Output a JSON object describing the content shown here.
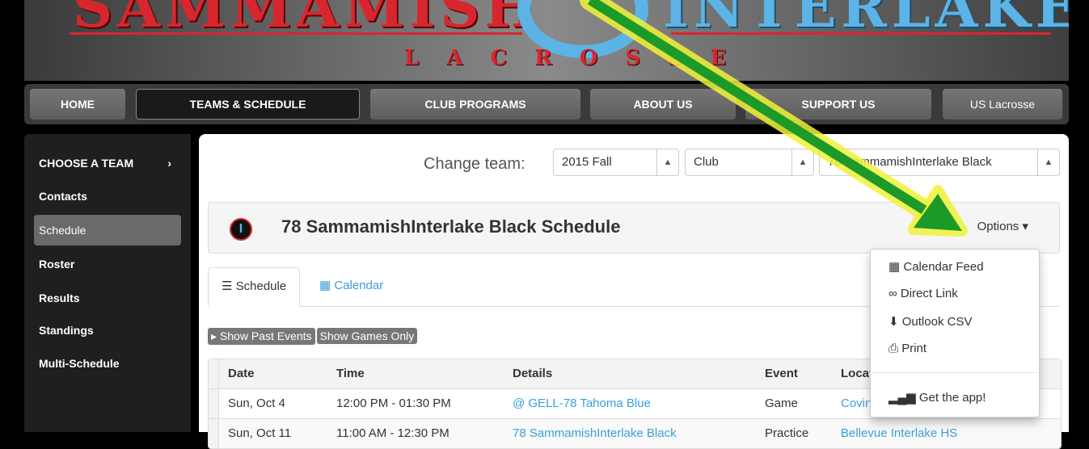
{
  "banner": {
    "left_word": "SAMMAMISH",
    "right_word": "INTERLAKE",
    "sub_word": "LACROSSE",
    "colors": {
      "red": "#d8262e",
      "blue": "#5bb4e5"
    }
  },
  "nav": {
    "items": [
      "HOME",
      "TEAMS & SCHEDULE",
      "CLUB PROGRAMS",
      "ABOUT US",
      "SUPPORT US",
      "US Lacrosse"
    ],
    "active": "TEAMS & SCHEDULE"
  },
  "sidebar": {
    "header": "CHOOSE A TEAM",
    "header_icon": "chevron-right-icon",
    "items": [
      "Contacts",
      "Schedule",
      "Roster",
      "Results",
      "Standings",
      "Multi-Schedule"
    ],
    "active": "Schedule"
  },
  "change_team": {
    "label": "Change team:",
    "season": "2015 Fall",
    "program": "Club",
    "team": "78 SammamishInterlake Black"
  },
  "schedule": {
    "title": "78 SammamishInterlake Black Schedule",
    "options_label": "Options",
    "tabs": [
      {
        "label": "Schedule",
        "icon": "list-icon"
      },
      {
        "label": "Calendar",
        "icon": "calendar-icon"
      }
    ],
    "buttons": {
      "past": "Show Past Events",
      "games_only": "Show Games Only"
    },
    "columns": [
      "Date",
      "Time",
      "Details",
      "Event",
      "Location"
    ],
    "rows": [
      {
        "date": "Sun, Oct 4",
        "time": "12:00 PM - 01:30 PM",
        "details": "@ GELL-78 Tahoma Blue",
        "event": "Game",
        "location": "Covington"
      },
      {
        "date": "Sun, Oct 11",
        "time": "11:00 AM - 12:30 PM",
        "details": "78 SammamishInterlake Black",
        "event": "Practice",
        "location": "Bellevue Interlake HS"
      }
    ]
  },
  "options_menu": {
    "items": [
      {
        "label": "Calendar Feed",
        "icon": "calendar-icon"
      },
      {
        "label": "Direct Link",
        "icon": "link-icon"
      },
      {
        "label": "Outlook CSV",
        "icon": "download-icon"
      },
      {
        "label": "Print",
        "icon": "print-icon"
      },
      {
        "label": "Get the app!",
        "icon": "signal-icon"
      }
    ]
  },
  "annotation": {
    "arrow_fill": "#1b9a2a",
    "arrow_glow": "#f2f23a"
  }
}
